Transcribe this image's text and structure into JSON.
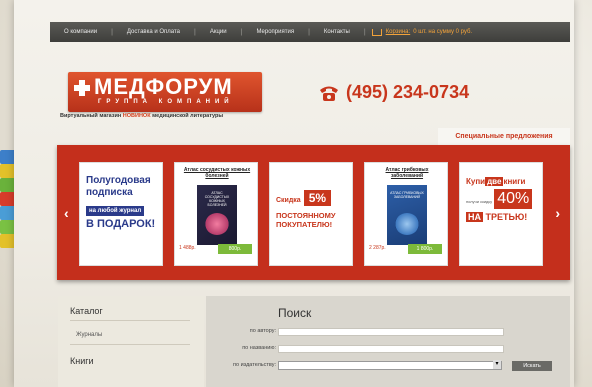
{
  "nav": {
    "items": [
      "О компании",
      "Доставка и Оплата",
      "Акции",
      "Мероприятия",
      "Контакты"
    ],
    "cart_link": "Корзина:",
    "cart_status": "0 шт. на сумму 0 руб."
  },
  "brand": {
    "name": "МЕДФОРУМ",
    "subtitle": "ГРУППА КОМПАНИЙ",
    "tagline_before": "Виртуальный магазин",
    "tagline_highlight": "НОВИНОК",
    "tagline_after": "медицинской литературы"
  },
  "phone": "(495) 234-0734",
  "specials_tab": "Специальные предложения",
  "slider": {
    "prev": "‹",
    "next": "›",
    "subscription": {
      "line1": "Полугодовая",
      "line2": "подписка",
      "pill": "на любой журнал",
      "line4": "В ПОДАРОК!"
    },
    "book1": {
      "title": "Атлас сосудистых кожных болезней",
      "cover_text": "АТЛАС СОСУДИСТЫХ КОЖНЫХ БОЛЕЗНЕЙ",
      "price": "1 488р.",
      "button": "800р."
    },
    "discount": {
      "label": "Скидка",
      "percent": "5%",
      "line2": "ПОСТОЯННОМУ",
      "line3": "ПОКУПАТЕЛЮ!"
    },
    "book2": {
      "title": "Атлас грибковых заболеваний",
      "cover_text": "АТЛАС ГРИБКОВЫХ ЗАБОЛЕВАНИЙ",
      "price": "2 287р.",
      "button": "1 800р."
    },
    "offer": {
      "part1": "Купи",
      "box": "две",
      "part2": "книги",
      "small": "получи скидку",
      "percent": "40%",
      "part3": "НА",
      "part4": "ТРЕТЬЮ!"
    }
  },
  "catalog": {
    "heading": "Каталог",
    "item": "Журналы",
    "heading2": "Книги"
  },
  "search": {
    "heading": "Поиск",
    "by_author": "по автору:",
    "by_title": "по названию:",
    "by_publisher": "по издательству:",
    "button": "Искать"
  }
}
